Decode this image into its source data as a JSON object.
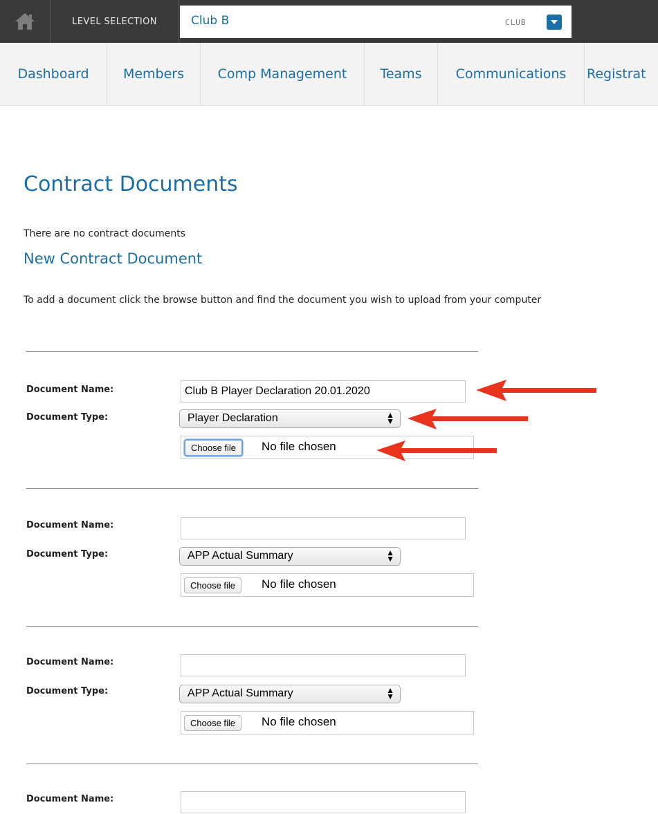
{
  "topbar": {
    "home_icon": "home-icon",
    "level_label": "LEVEL SELECTION",
    "level_value": "Club B",
    "level_type": "CLUB",
    "dropdown_icon": "chevron-down-icon"
  },
  "nav": {
    "items": [
      "Dashboard",
      "Members",
      "Comp Management",
      "Teams",
      "Communications",
      "Registrat"
    ]
  },
  "main": {
    "page_title": "Contract Documents",
    "empty_message": "There are no contract documents",
    "section_title": "New Contract Document",
    "instruction": "To add a document click the browse button and find the document you wish to upload from your computer"
  },
  "form": {
    "name_label": "Document Name:",
    "type_label": "Document Type:",
    "choose_file_label": "Choose file",
    "no_file_text": "No file chosen",
    "rows": [
      {
        "name_value": "Club B Player Declaration 20.01.2020",
        "type_value": "Player Declaration"
      },
      {
        "name_value": "",
        "type_value": "APP Actual Summary"
      },
      {
        "name_value": "",
        "type_value": "APP Actual Summary"
      },
      {
        "name_value": ""
      }
    ]
  },
  "annotations": {
    "arrow_color": "#e8341c"
  }
}
